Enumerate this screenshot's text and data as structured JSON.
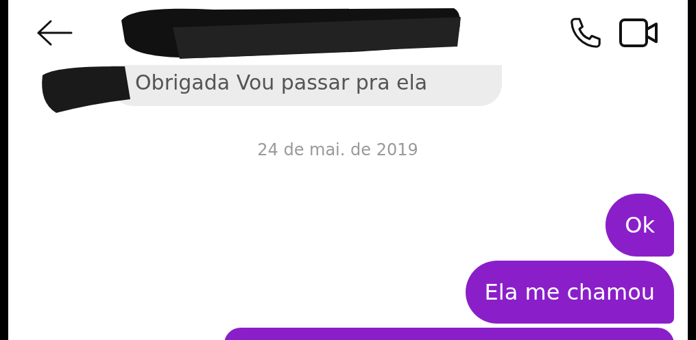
{
  "header": {
    "actions": [
      {
        "kind": "call"
      },
      {
        "kind": "video"
      }
    ]
  },
  "messages": [
    {
      "kind": "incoming",
      "text": "Obrigada Vou passar pra ela"
    },
    {
      "kind": "date",
      "text": "24 de mai. de 2019"
    },
    {
      "kind": "outgoing",
      "text": "Ok"
    },
    {
      "kind": "outgoing",
      "text": "Ela me chamou"
    },
    {
      "kind": "outgoing"
    }
  ]
}
